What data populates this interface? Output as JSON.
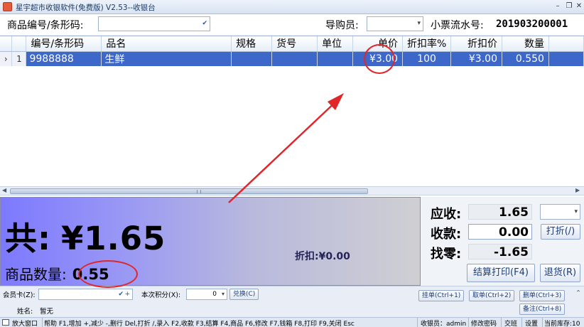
{
  "window": {
    "title": "星宇超市收银软件(免费版) V2.53--收银台",
    "icon": "cash-register-icon",
    "controls": [
      "minimize-icon",
      "restore-icon",
      "close-icon"
    ]
  },
  "topbar": {
    "barcode_label": "商品编号/条形码:",
    "barcode_value": "",
    "guide_label": "导购员:",
    "guide_value": "",
    "ticket_label": "小票流水号:",
    "ticket_value": "201903200001"
  },
  "grid": {
    "columns": [
      "编号/条形码",
      "品名",
      "规格",
      "货号",
      "单位",
      "单价",
      "折扣率%",
      "折扣价",
      "数量"
    ],
    "rows": [
      {
        "index": "1",
        "cells": [
          "9988888",
          "生鲜",
          "",
          "",
          "",
          "¥3.00",
          "100",
          "¥3.00",
          "0.550"
        ]
      }
    ]
  },
  "summary": {
    "total_label": "共:",
    "total_value": "¥1.65",
    "qty_label": "商品数量:",
    "qty_value": "0.55",
    "discount_label": "折扣:",
    "discount_value": "¥0.00"
  },
  "payment": {
    "due_label": "应收:",
    "due_value": "1.65",
    "received_label": "收款:",
    "received_value": "0.00",
    "change_label": "找零:",
    "change_value": "-1.65",
    "discount_button": "打折(/)",
    "checkout_button": "结算打印(F4)",
    "refund_button": "退货(R)"
  },
  "member": {
    "card_label": "会员卡(Z):",
    "card_value": "",
    "points_label": "本次积分(X):",
    "points_value": "0",
    "redeem_button": "兑换(C)",
    "name_label": "姓名:",
    "name_value": "暂无"
  },
  "actions": {
    "hold": "挂单(Ctrl+1)",
    "retrieve": "取单(Ctrl+2)",
    "delete": "删单(Ctrl+3)",
    "note": "备注(Ctrl+8)"
  },
  "statusbar": {
    "maximize": "放大窗口",
    "help": "帮助 F1,增加 +,减少 -,删行 Del,打折 /,录入 F2,收款 F3,结算 F4,商品 F6,修改 F7,钱箱 F8,打印 F9,关闭 Esc",
    "cashier": "收银员：admin",
    "change_password": "修改密码",
    "shift": "交班",
    "settings": "设置",
    "stock": "当前库存:10"
  },
  "colors": {
    "selected_row": "#3d67c8",
    "annotation": "#e0262a",
    "panel_gradient_start": "#7d79ff"
  }
}
